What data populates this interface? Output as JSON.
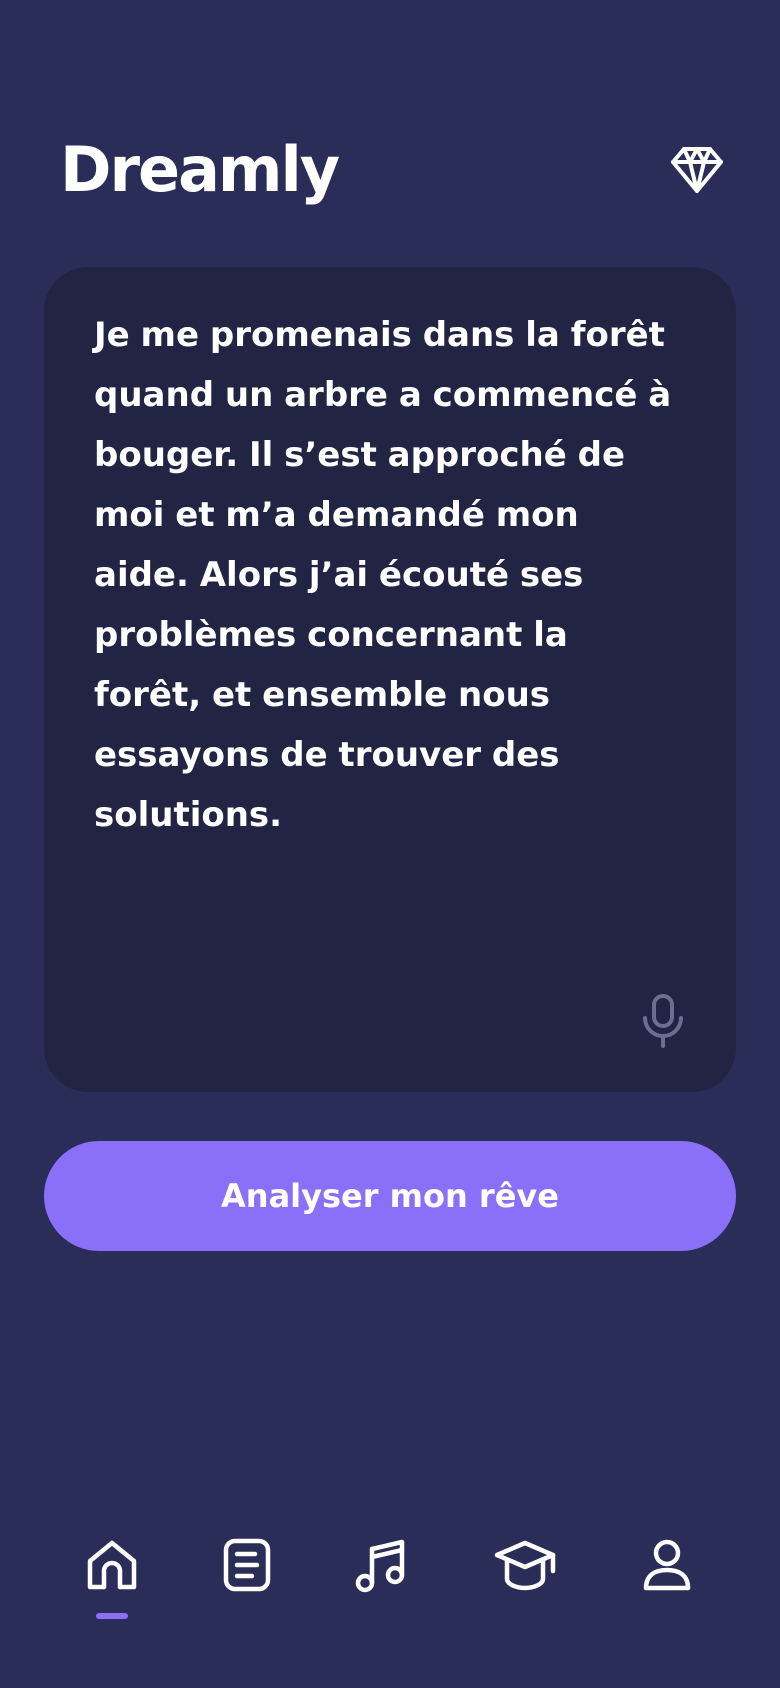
{
  "header": {
    "title": "Dreamly",
    "premium_icon": "diamond-icon"
  },
  "dream": {
    "text": "Je me promenais dans la forêt quand un arbre a commencé à bouger. Il s’est approché de moi et m’a demandé mon aide. Alors j’ai écouté ses problèmes concernant la forêt, et ensemble nous essayons de trouver des solutions.",
    "mic_icon": "microphone-icon"
  },
  "actions": {
    "analyze_label": "Analyser mon rêve"
  },
  "nav": {
    "items": [
      {
        "icon": "home-icon",
        "active": true
      },
      {
        "icon": "journal-icon",
        "active": false
      },
      {
        "icon": "music-note-icon",
        "active": false
      },
      {
        "icon": "graduation-cap-icon",
        "active": false
      },
      {
        "icon": "profile-icon",
        "active": false
      }
    ]
  },
  "colors": {
    "background": "#2a2d57",
    "card": "#222444",
    "accent": "#8a6ff9",
    "muted_icon": "#6b6e93"
  }
}
